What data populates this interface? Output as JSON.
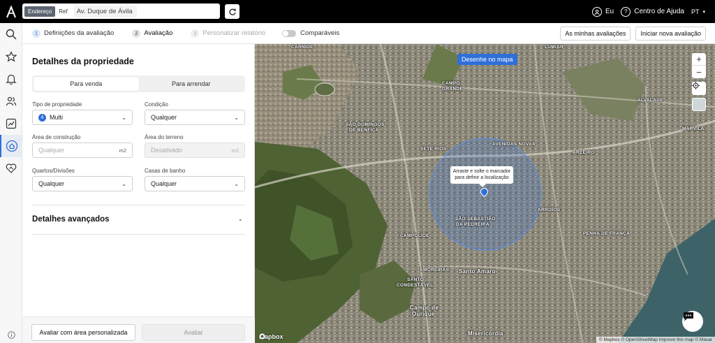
{
  "topbar": {
    "search_modes": [
      "Endereço",
      "Ref"
    ],
    "search_value": "Av. Duque de Ávila ...",
    "user_label": "Eu",
    "help_label": "Centro de Ajuda",
    "lang_label": "PT"
  },
  "steps": [
    {
      "num": "1",
      "label": "Definições da avaliação"
    },
    {
      "num": "2",
      "label": "Avaliação"
    },
    {
      "num": "3",
      "label": "Personalizar relatório"
    }
  ],
  "comparaveis_label": "Comparáveis",
  "header_buttons": {
    "my_evaluations": "As minhas avaliações",
    "new_evaluation": "Iniciar nova avaliação"
  },
  "panel": {
    "title": "Detalhes da propriedade",
    "tabs": [
      "Para venda",
      "Para arrendar"
    ],
    "property_type": {
      "label": "Tipo de propriedade",
      "badge": "4",
      "value": "Multi"
    },
    "condition": {
      "label": "Condição",
      "value": "Qualquer"
    },
    "built_area": {
      "label": "Área de construção",
      "placeholder": "Qualquer",
      "unit": "m2"
    },
    "land_area": {
      "label": "Área do terreno",
      "placeholder": "Desativado",
      "unit": "m2"
    },
    "rooms": {
      "label": "Quartos/Divisões",
      "value": "Qualquer"
    },
    "baths": {
      "label": "Casas de banho",
      "value": "Qualquer"
    },
    "advanced_title": "Detalhes avançados",
    "btn_custom_area": "Avaliar com área personalizada",
    "btn_evaluate": "Avaliar"
  },
  "map": {
    "draw_button": "Desenhe no mapa",
    "tooltip_line1": "Arraste e solte o marcador",
    "tooltip_line2": "para definir a localização",
    "mapbox_label": "mapbox",
    "attribution": "© Mapbox © OpenStreetMap Improve this map © Maxar",
    "labels": [
      {
        "text": "CARNIDE"
      },
      {
        "text": "LUMIAR"
      },
      {
        "text": "CAMPO"
      },
      {
        "text": "GRANDE"
      },
      {
        "text": "SÃO DOMINGOS"
      },
      {
        "text": "DE BENFICA"
      },
      {
        "text": "ALVALADE"
      },
      {
        "text": "MARVILA"
      },
      {
        "text": "SETE RIOS"
      },
      {
        "text": "AVENIDAS NOVAS"
      },
      {
        "text": "AREEIRO"
      },
      {
        "text": "ARROIOS"
      },
      {
        "text": "SÃO SEBASTIÃO"
      },
      {
        "text": "DA PEDREIRA"
      },
      {
        "text": "CAMPOLIDE"
      },
      {
        "text": "AMOREIRAS"
      },
      {
        "text": "Santo Amaro"
      },
      {
        "text": "SANTO"
      },
      {
        "text": "CONDESTÁVEL"
      },
      {
        "text": "Campo de"
      },
      {
        "text": "Ourique"
      },
      {
        "text": "PENHA DE FRANÇA"
      },
      {
        "text": "Misericórdia"
      }
    ]
  }
}
